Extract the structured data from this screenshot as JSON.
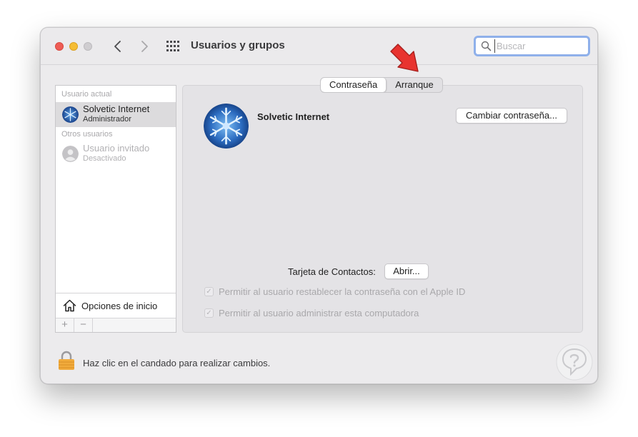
{
  "window": {
    "title": "Usuarios y grupos",
    "search_placeholder": "Buscar"
  },
  "sidebar": {
    "current_user_header": "Usuario actual",
    "current_user": {
      "name": "Solvetic Internet",
      "role": "Administrador"
    },
    "other_users_header": "Otros usuarios",
    "guest_user": {
      "name": "Usuario invitado",
      "role": "Desactivado"
    },
    "login_options_label": "Opciones de inicio",
    "add_label": "+",
    "remove_label": "−"
  },
  "tabs": [
    {
      "label": "Contraseña",
      "active": true
    },
    {
      "label": "Arranque",
      "active": false
    }
  ],
  "main": {
    "user_full_name": "Solvetic Internet",
    "change_password_label": "Cambiar contraseña...",
    "contact_card_label": "Tarjeta de Contactos:",
    "open_label": "Abrir...",
    "checkboxes": [
      {
        "label": "Permitir al usuario restablecer la contraseña con el Apple ID",
        "checked": true
      },
      {
        "label": "Permitir al usuario administrar esta computadora",
        "checked": true
      }
    ]
  },
  "footer": {
    "lock_text": "Haz clic en el candado para realizar cambios."
  },
  "icons": [
    "back-chevron-icon",
    "forward-chevron-icon",
    "grid-icon",
    "search-icon",
    "house-icon",
    "lock-icon",
    "red-arrow-icon"
  ],
  "colors": {
    "accent_search_border": "#8fb0ea",
    "annotation_arrow": "#e8332f"
  }
}
